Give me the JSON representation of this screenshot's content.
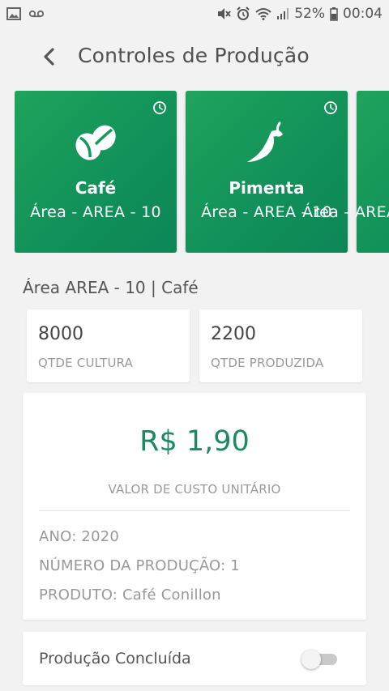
{
  "status_bar": {
    "battery": "52%",
    "time": "00:04",
    "icons": [
      "image-icon",
      "voicemail-icon",
      "mute-icon",
      "alarm-icon",
      "wifi-icon",
      "signal-icon",
      "battery-icon"
    ]
  },
  "header": {
    "title": "Controles de Produção",
    "back_icon": "chevron-left-icon"
  },
  "crops": [
    {
      "name": "Café",
      "area": "Área - AREA - 10",
      "icon": "coffee-bean-icon"
    },
    {
      "name": "Pimenta",
      "area": "Área - AREA - 10",
      "icon": "pepper-icon"
    }
  ],
  "selection": {
    "heading": "Área AREA - 10 | Café"
  },
  "stats": {
    "cultura": {
      "value": "8000",
      "label": "QTDE CULTURA"
    },
    "produzida": {
      "value": "2200",
      "label": "QTDE PRODUZIDA"
    }
  },
  "cost": {
    "value": "R$ 1,90",
    "label": "VALOR DE CUSTO UNITÁRIO",
    "ano": "ANO: 2020",
    "numero": "NÚMERO DA PRODUÇÃO: 1",
    "produto": "PRODUTO: Café Conillon"
  },
  "toggle": {
    "label": "Produção Concluída",
    "checked": false
  },
  "colors": {
    "card_green": "#11905a",
    "accent_teal": "#1b8a63",
    "background": "#f2f2f2"
  }
}
